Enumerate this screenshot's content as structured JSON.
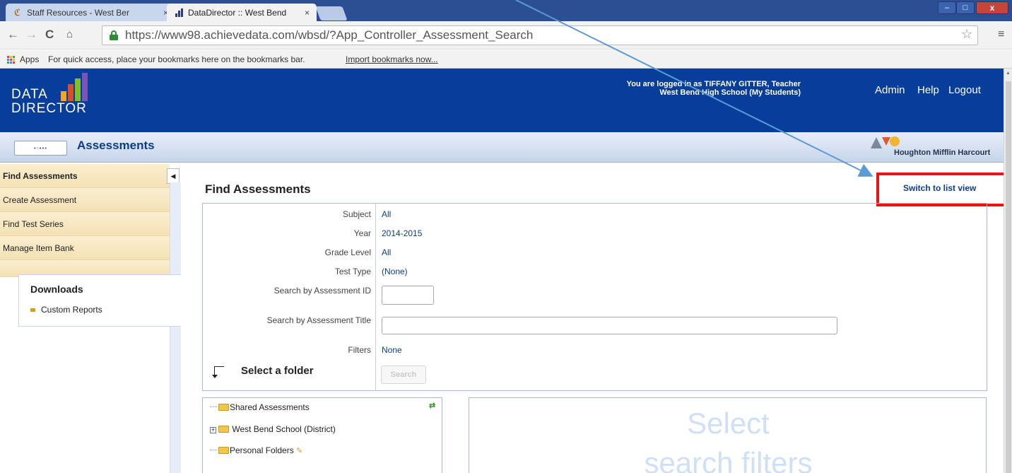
{
  "browser": {
    "tabs": [
      {
        "title": "Staff Resources - West Ber",
        "active": false
      },
      {
        "title": "DataDirector :: West Bend",
        "active": true
      }
    ],
    "tab_close": "×",
    "url": "https://www98.achievedata.com/wbsd/?App_Controller_Assessment_Search",
    "nav": {
      "back": "←",
      "forward": "→",
      "reload": "C",
      "home": "🏠"
    },
    "star": "☆",
    "menu": "≡",
    "bookmarks": {
      "apps_label": "Apps",
      "message": "For quick access, place your bookmarks here on the bookmarks bar.",
      "import_link": "Import bookmarks now..."
    },
    "window_controls": {
      "minimize": "–",
      "maximize": "□",
      "close": "x"
    }
  },
  "header": {
    "logo_line1": "DATA",
    "logo_line2": "DIRECTOR",
    "logged_in_line1": "You are logged in as TIFFANY GITTER, Teacher",
    "logged_in_line2": "West Bend High School (My Students)",
    "nav": [
      "Admin",
      "Help",
      "Logout"
    ]
  },
  "subheader": {
    "module_button": "▪▫▪▪▪",
    "title": "Assessments",
    "brand": "Houghton Mifflin Harcourt",
    "brand_colors": {
      "triangle": "#7a8a9c",
      "square": "#e05a2a",
      "circle": "#f3b42e"
    }
  },
  "sidebar": {
    "items": [
      {
        "label": "Find Assessments",
        "selected": true
      },
      {
        "label": "Create Assessment",
        "selected": false
      },
      {
        "label": "Find Test Series",
        "selected": false
      },
      {
        "label": "Manage Item Bank",
        "selected": false
      }
    ],
    "collapse_glyph": "◀",
    "downloads": {
      "title": "Downloads",
      "items": [
        "Custom Reports"
      ]
    }
  },
  "main": {
    "title": "Find Assessments",
    "switch_view_link": "Switch to list view",
    "filters": [
      {
        "label": "Subject",
        "value": "All"
      },
      {
        "label": "Year",
        "value": "2014-2015"
      },
      {
        "label": "Grade Level",
        "value": "All"
      },
      {
        "label": "Test Type",
        "value": "(None)"
      }
    ],
    "search_id_label": "Search by Assessment ID",
    "search_id_value": "",
    "search_title_label": "Search by Assessment Title",
    "search_title_value": "",
    "filters_label": "Filters",
    "filters_value": "None",
    "select_folder": "Select a folder",
    "search_button": "Search",
    "tree": {
      "refresh_icon": "⇄",
      "items": [
        {
          "label": "Shared Assessments",
          "expandable": false
        },
        {
          "label": "West Bend School (District)",
          "expandable": true
        },
        {
          "label": "Personal Folders",
          "expandable": false
        }
      ]
    },
    "placeholder_line1": "Select",
    "placeholder_line2": "search filters"
  },
  "colors": {
    "header_blue": "#073e9c",
    "link_blue": "#0d3c8e",
    "highlight_red": "#ee1111",
    "annotation_arrow": "#5b9bd5",
    "logo_bars": [
      "#f6a623",
      "#d94f24",
      "#7fbf2a",
      "#7a55b6"
    ]
  }
}
